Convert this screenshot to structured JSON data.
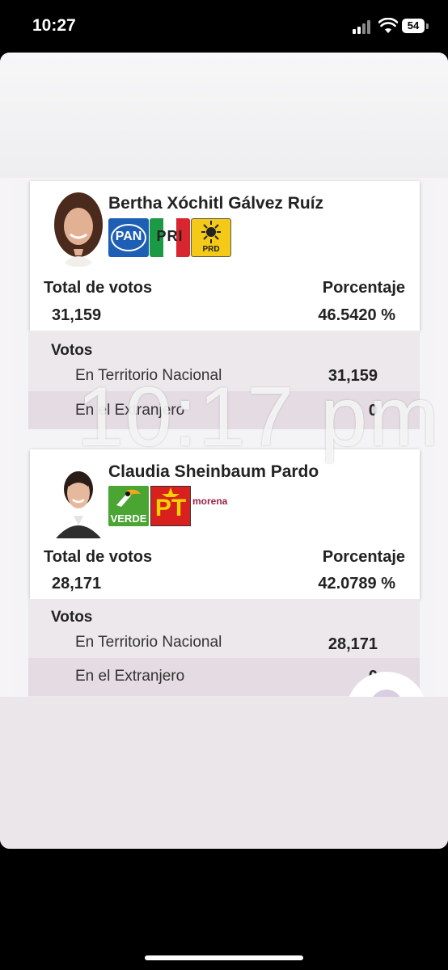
{
  "status_bar": {
    "time": "10:27",
    "battery": "54"
  },
  "overlay": {
    "time_text": "10:17 pm"
  },
  "candidates": [
    {
      "name": "Bertha Xóchitl Gálvez Ruíz",
      "parties": [
        "PAN",
        "PRI",
        "PRD"
      ],
      "total_label": "Total de votos",
      "total_value": "31,159",
      "percent_label": "Porcentaje",
      "percent_value": "46.5420 %",
      "votos_title": "Votos",
      "national_label": "En Territorio Nacional",
      "national_value": "31,159",
      "abroad_label": "En el Extranjero",
      "abroad_value": "0"
    },
    {
      "name": "Claudia Sheinbaum Pardo",
      "parties": [
        "VERDE",
        "PT",
        "morena"
      ],
      "total_label": "Total de votos",
      "total_value": "28,171",
      "percent_label": "Porcentaje",
      "percent_value": "42.0789 %",
      "votos_title": "Votos",
      "national_label": "En Territorio Nacional",
      "national_value": "28,171",
      "abroad_label": "En el Extranjero",
      "abroad_value": "0"
    }
  ],
  "logos": {
    "pan": "PAN",
    "pri": "PRI",
    "prd": "PRD",
    "verde": "VERDE",
    "pt": "PT",
    "morena": "morena"
  },
  "colors": {
    "pan_blue": "#1d5fb4",
    "pri_red": "#d8262e",
    "pri_green": "#1a9a45",
    "prd_yellow": "#f5c917",
    "verde_green": "#4aa533",
    "pt_red": "#d8201f",
    "morena_maroon": "#9b2245"
  },
  "icons": [
    "signal-icon",
    "wifi-icon",
    "battery-icon"
  ]
}
